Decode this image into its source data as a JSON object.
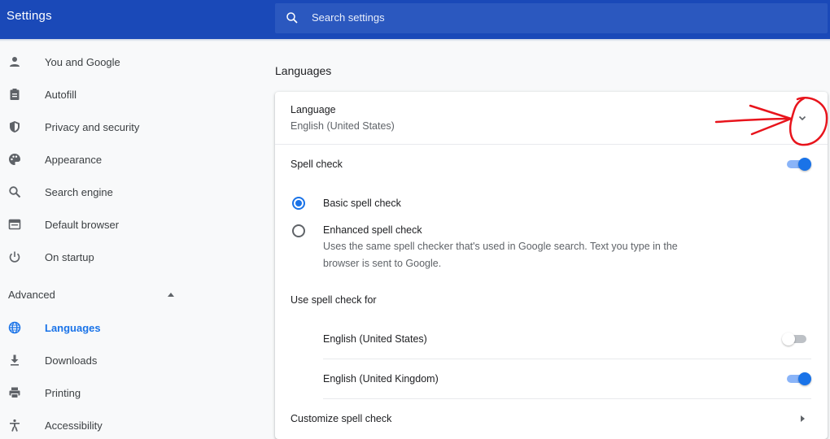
{
  "header": {
    "title": "Settings",
    "search_placeholder": "Search settings"
  },
  "sidebar": {
    "items": [
      {
        "label": "You and Google",
        "icon": "person-icon"
      },
      {
        "label": "Autofill",
        "icon": "clipboard-icon"
      },
      {
        "label": "Privacy and security",
        "icon": "shield-icon"
      },
      {
        "label": "Appearance",
        "icon": "palette-icon"
      },
      {
        "label": "Search engine",
        "icon": "search-icon"
      },
      {
        "label": "Default browser",
        "icon": "browser-icon"
      },
      {
        "label": "On startup",
        "icon": "power-icon"
      }
    ],
    "advanced_label": "Advanced",
    "advanced_items": [
      {
        "label": "Languages",
        "icon": "globe-icon",
        "active": true
      },
      {
        "label": "Downloads",
        "icon": "download-icon"
      },
      {
        "label": "Printing",
        "icon": "printer-icon"
      },
      {
        "label": "Accessibility",
        "icon": "accessibility-icon"
      }
    ]
  },
  "main": {
    "section_title": "Languages",
    "language": {
      "label": "Language",
      "value": "English (United States)"
    },
    "spell_check": {
      "label": "Spell check",
      "enabled": true,
      "basic_label": "Basic spell check",
      "enhanced_label": "Enhanced spell check",
      "enhanced_desc_1": "Uses the same spell checker that's used in Google search. Text you type in the",
      "enhanced_desc_2": "browser is sent to Google.",
      "selected": "basic"
    },
    "use_for": {
      "label": "Use spell check for",
      "languages": [
        {
          "name": "English (United States)",
          "enabled": false
        },
        {
          "name": "English (United Kingdom)",
          "enabled": true
        }
      ]
    },
    "customize_label": "Customize spell check"
  },
  "colors": {
    "header": "#1a49b8",
    "accent": "#1a73e8",
    "annotation": "#e8141c"
  }
}
